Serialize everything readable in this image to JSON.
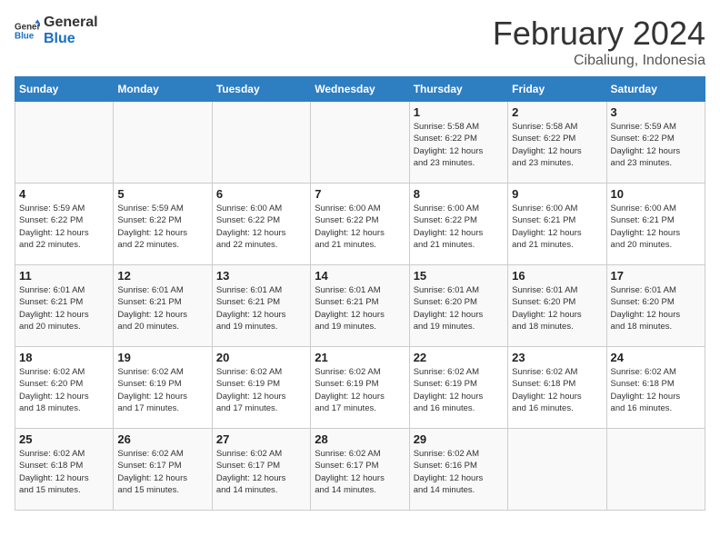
{
  "header": {
    "logo_line1": "General",
    "logo_line2": "Blue",
    "title": "February 2024",
    "subtitle": "Cibaliung, Indonesia"
  },
  "weekdays": [
    "Sunday",
    "Monday",
    "Tuesday",
    "Wednesday",
    "Thursday",
    "Friday",
    "Saturday"
  ],
  "weeks": [
    [
      {
        "day": "",
        "info": ""
      },
      {
        "day": "",
        "info": ""
      },
      {
        "day": "",
        "info": ""
      },
      {
        "day": "",
        "info": ""
      },
      {
        "day": "1",
        "info": "Sunrise: 5:58 AM\nSunset: 6:22 PM\nDaylight: 12 hours\nand 23 minutes."
      },
      {
        "day": "2",
        "info": "Sunrise: 5:58 AM\nSunset: 6:22 PM\nDaylight: 12 hours\nand 23 minutes."
      },
      {
        "day": "3",
        "info": "Sunrise: 5:59 AM\nSunset: 6:22 PM\nDaylight: 12 hours\nand 23 minutes."
      }
    ],
    [
      {
        "day": "4",
        "info": "Sunrise: 5:59 AM\nSunset: 6:22 PM\nDaylight: 12 hours\nand 22 minutes."
      },
      {
        "day": "5",
        "info": "Sunrise: 5:59 AM\nSunset: 6:22 PM\nDaylight: 12 hours\nand 22 minutes."
      },
      {
        "day": "6",
        "info": "Sunrise: 6:00 AM\nSunset: 6:22 PM\nDaylight: 12 hours\nand 22 minutes."
      },
      {
        "day": "7",
        "info": "Sunrise: 6:00 AM\nSunset: 6:22 PM\nDaylight: 12 hours\nand 21 minutes."
      },
      {
        "day": "8",
        "info": "Sunrise: 6:00 AM\nSunset: 6:22 PM\nDaylight: 12 hours\nand 21 minutes."
      },
      {
        "day": "9",
        "info": "Sunrise: 6:00 AM\nSunset: 6:21 PM\nDaylight: 12 hours\nand 21 minutes."
      },
      {
        "day": "10",
        "info": "Sunrise: 6:00 AM\nSunset: 6:21 PM\nDaylight: 12 hours\nand 20 minutes."
      }
    ],
    [
      {
        "day": "11",
        "info": "Sunrise: 6:01 AM\nSunset: 6:21 PM\nDaylight: 12 hours\nand 20 minutes."
      },
      {
        "day": "12",
        "info": "Sunrise: 6:01 AM\nSunset: 6:21 PM\nDaylight: 12 hours\nand 20 minutes."
      },
      {
        "day": "13",
        "info": "Sunrise: 6:01 AM\nSunset: 6:21 PM\nDaylight: 12 hours\nand 19 minutes."
      },
      {
        "day": "14",
        "info": "Sunrise: 6:01 AM\nSunset: 6:21 PM\nDaylight: 12 hours\nand 19 minutes."
      },
      {
        "day": "15",
        "info": "Sunrise: 6:01 AM\nSunset: 6:20 PM\nDaylight: 12 hours\nand 19 minutes."
      },
      {
        "day": "16",
        "info": "Sunrise: 6:01 AM\nSunset: 6:20 PM\nDaylight: 12 hours\nand 18 minutes."
      },
      {
        "day": "17",
        "info": "Sunrise: 6:01 AM\nSunset: 6:20 PM\nDaylight: 12 hours\nand 18 minutes."
      }
    ],
    [
      {
        "day": "18",
        "info": "Sunrise: 6:02 AM\nSunset: 6:20 PM\nDaylight: 12 hours\nand 18 minutes."
      },
      {
        "day": "19",
        "info": "Sunrise: 6:02 AM\nSunset: 6:19 PM\nDaylight: 12 hours\nand 17 minutes."
      },
      {
        "day": "20",
        "info": "Sunrise: 6:02 AM\nSunset: 6:19 PM\nDaylight: 12 hours\nand 17 minutes."
      },
      {
        "day": "21",
        "info": "Sunrise: 6:02 AM\nSunset: 6:19 PM\nDaylight: 12 hours\nand 17 minutes."
      },
      {
        "day": "22",
        "info": "Sunrise: 6:02 AM\nSunset: 6:19 PM\nDaylight: 12 hours\nand 16 minutes."
      },
      {
        "day": "23",
        "info": "Sunrise: 6:02 AM\nSunset: 6:18 PM\nDaylight: 12 hours\nand 16 minutes."
      },
      {
        "day": "24",
        "info": "Sunrise: 6:02 AM\nSunset: 6:18 PM\nDaylight: 12 hours\nand 16 minutes."
      }
    ],
    [
      {
        "day": "25",
        "info": "Sunrise: 6:02 AM\nSunset: 6:18 PM\nDaylight: 12 hours\nand 15 minutes."
      },
      {
        "day": "26",
        "info": "Sunrise: 6:02 AM\nSunset: 6:17 PM\nDaylight: 12 hours\nand 15 minutes."
      },
      {
        "day": "27",
        "info": "Sunrise: 6:02 AM\nSunset: 6:17 PM\nDaylight: 12 hours\nand 14 minutes."
      },
      {
        "day": "28",
        "info": "Sunrise: 6:02 AM\nSunset: 6:17 PM\nDaylight: 12 hours\nand 14 minutes."
      },
      {
        "day": "29",
        "info": "Sunrise: 6:02 AM\nSunset: 6:16 PM\nDaylight: 12 hours\nand 14 minutes."
      },
      {
        "day": "",
        "info": ""
      },
      {
        "day": "",
        "info": ""
      }
    ]
  ]
}
